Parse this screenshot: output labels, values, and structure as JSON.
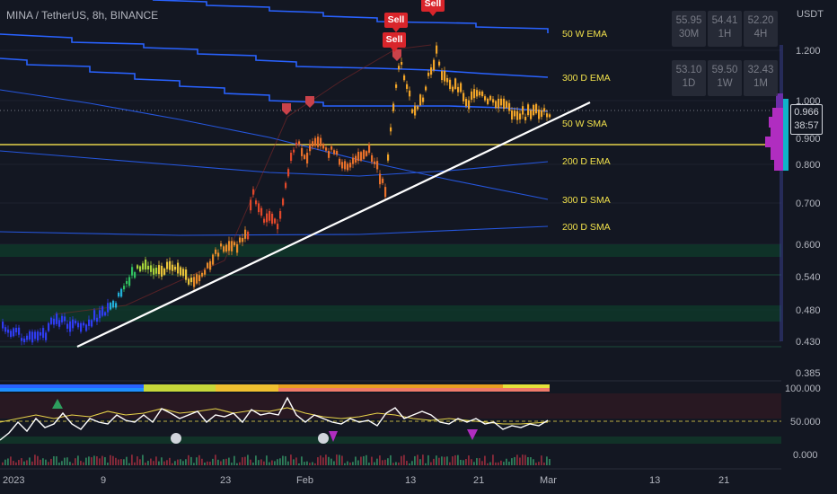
{
  "header": {
    "symbol": "MINA / TetherUS, 8h, BINANCE",
    "currency": "USDT"
  },
  "price_axis": {
    "ticks": [
      "1.200",
      "1.000",
      "0.900",
      "0.800",
      "0.700",
      "0.600",
      "0.540",
      "0.480",
      "0.430",
      "0.385"
    ],
    "current_price": "0.966",
    "countdown": "38:57"
  },
  "oscillator_axis": {
    "ticks": [
      "100.000",
      "50.000",
      "0.000"
    ]
  },
  "time_axis": {
    "ticks": [
      "2023",
      "9",
      "23",
      "Feb",
      "13",
      "21",
      "Mar",
      "13",
      "21"
    ]
  },
  "ma_labels": [
    "50 W EMA",
    "300 D EMA",
    "50 W SMA",
    "200 D EMA",
    "300 D SMA",
    "200 D SMA"
  ],
  "rsi_table": [
    {
      "value": "55.95",
      "tf": "30M"
    },
    {
      "value": "54.41",
      "tf": "1H"
    },
    {
      "value": "52.20",
      "tf": "4H"
    },
    {
      "value": "53.10",
      "tf": "1D"
    },
    {
      "value": "59.50",
      "tf": "1W"
    },
    {
      "value": "32.43",
      "tf": "1M"
    }
  ],
  "signals": {
    "sell_label": "Sell"
  },
  "colors": {
    "background": "#131722",
    "ma_line": "#2962ff",
    "trendline": "#ffffff",
    "sell": "#d9252b",
    "ma_text": "#f0e04b"
  }
}
